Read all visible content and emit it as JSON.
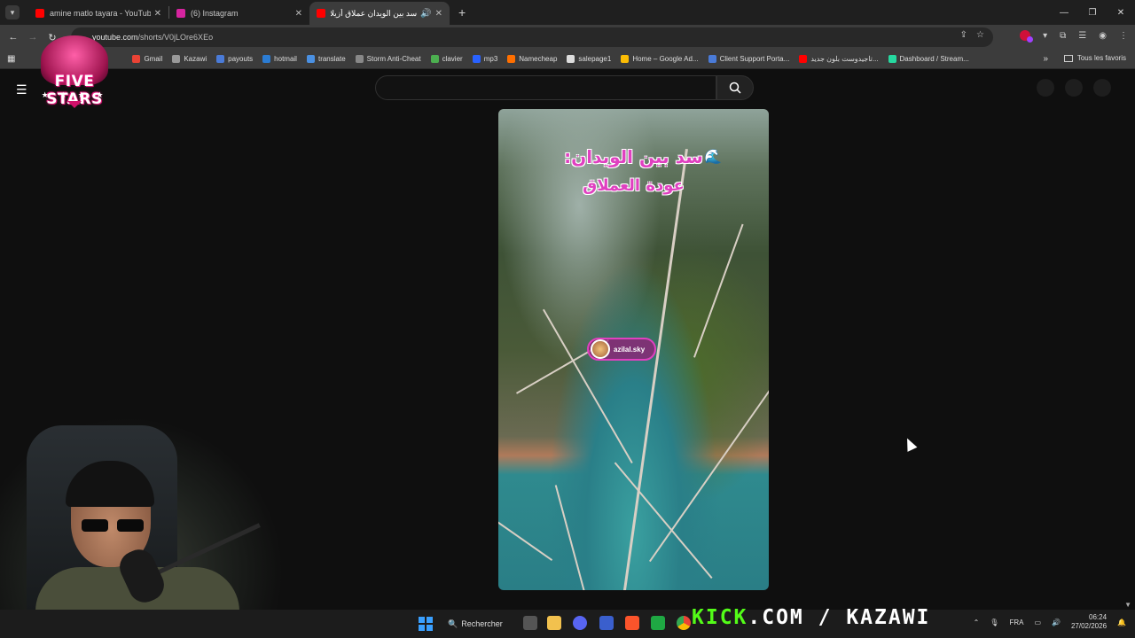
{
  "tabs": [
    {
      "title": "amine matlo tayara - YouTube",
      "favicon_color": "#ff0000"
    },
    {
      "title": "(6) Instagram",
      "favicon_color": "#d6249f"
    },
    {
      "title": "سد بين الويدان عملاق أزيلال",
      "favicon_color": "#ff0000",
      "audio_icon": "speaker-icon"
    }
  ],
  "address": {
    "host": "youtube.com",
    "path": "/shorts/V0jLOre6XEo"
  },
  "bookmarks": [
    {
      "label": "Gmail",
      "color": "#ea4335"
    },
    {
      "label": "Kazawi",
      "color": "#999999"
    },
    {
      "label": "payouts",
      "color": "#4a7bd8"
    },
    {
      "label": "hotmail",
      "color": "#2b7cd3"
    },
    {
      "label": "translate",
      "color": "#4a90e2"
    },
    {
      "label": "Storm Anti-Cheat",
      "color": "#888888"
    },
    {
      "label": "clavier",
      "color": "#4caf50"
    },
    {
      "label": "mp3",
      "color": "#2962ff"
    },
    {
      "label": "Namecheap",
      "color": "#ff6f00"
    },
    {
      "label": "salepage1",
      "color": "#dddddd"
    },
    {
      "label": "Home – Google Ad...",
      "color": "#fbbc04"
    },
    {
      "label": "Client Support Porta...",
      "color": "#4a7bd8"
    },
    {
      "label": "تاجيدوست بلون جديد...",
      "color": "#ff0000"
    },
    {
      "label": "Dashboard / Stream...",
      "color": "#26d9a0"
    }
  ],
  "bookmarks_all": "Tous les favoris",
  "logo": {
    "text": "FIVE STARS",
    "stars": "★ ★ ★ ★"
  },
  "video": {
    "title_line1": "سد بين الويدان:",
    "title_line2": "عودة العملاق",
    "wave_icon": "wave-emoji",
    "creator_badge": "azilal.sky"
  },
  "taskbar": {
    "search_label": "Rechercher",
    "stream_text_green": "KICK",
    "stream_text_white": ".COM / KAZAWI",
    "language": "FRA",
    "time": "06:24",
    "date": "27/02/2026"
  },
  "colors": {
    "kick_green": "#53fc18",
    "title_magenta": "#e040c0",
    "logo_pink": "#e0197a"
  }
}
